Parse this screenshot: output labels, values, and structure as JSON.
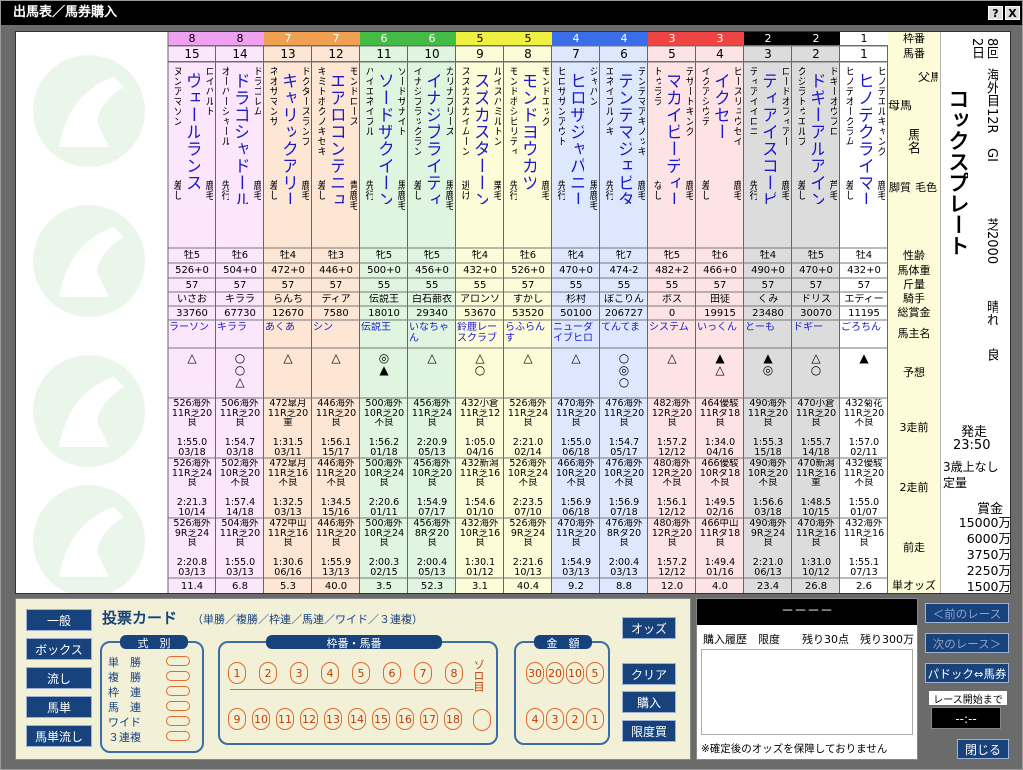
{
  "window": {
    "title": "出馬表／馬券購入",
    "help": "?",
    "close": "X"
  },
  "race": {
    "kai": "8回",
    "place_day": "海外目",
    "day": "2日",
    "race_no": "12R",
    "grade": "GI",
    "name": "コックスプレート",
    "course": "芝2000",
    "weather": "晴れ",
    "ground": "良",
    "start_label": "発走",
    "start_time": "23:50",
    "condition": "3歳上なし",
    "weight_rule": "定量",
    "prize_label": "賞金",
    "prizes": [
      "15000万",
      "6000万",
      "3750万",
      "2250万",
      "1500万"
    ]
  },
  "row_labels": {
    "waku": "枠番",
    "uma": "馬番",
    "dad": "父馬",
    "mom": "母馬",
    "name": "馬名",
    "leg": "脚質",
    "coat": "毛色",
    "sex_age": "性齢",
    "weight": "馬体重",
    "kin": "斤量",
    "jockey": "騎手",
    "money": "総賞金",
    "owner": "馬主名",
    "yoso": "予想",
    "r3": "3走前",
    "r2": "2走前",
    "r1": "前走",
    "odds": "単オッズ"
  },
  "columns": [
    {
      "waku": "8",
      "uma": "15",
      "name": "ヴェールランス",
      "dad": "ロイバルト",
      "mom": "ヌンアマソン",
      "leg": "差し",
      "coat": "鹿毛",
      "sex_age": "牡5",
      "weight": "526+0",
      "kin": "57",
      "jockey": "いさお",
      "money": "33760",
      "owner": "ラーソン",
      "yoso": [
        "△"
      ],
      "r3": [
        "526海外",
        "11R芝20",
        "良",
        "",
        "1:55.0",
        "03/18"
      ],
      "r2": [
        "526海外",
        "11R芝24",
        "良",
        "",
        "2:21.3",
        "10/14"
      ],
      "r1": [
        "526海外",
        "9R芝24",
        "良",
        "",
        "2:20.8",
        "03/13"
      ],
      "odds": "11.4"
    },
    {
      "waku": "8",
      "uma": "14",
      "name": "ドラゴシャドール",
      "dad": "ドラゴレム",
      "mom": "オーバーシャール",
      "leg": "先行",
      "coat": "鹿毛",
      "sex_age": "牡6",
      "weight": "504+0",
      "kin": "57",
      "jockey": "キララ",
      "money": "67730",
      "owner": "キララ",
      "yoso": [
        "○",
        "○",
        "△"
      ],
      "r3": [
        "506海外",
        "11R芝20",
        "良",
        "",
        "1:54.7",
        "03/18"
      ],
      "r2": [
        "502海外",
        "10R芝20",
        "不良",
        "",
        "1:57.4",
        "14/18"
      ],
      "r1": [
        "504海外",
        "11R芝20",
        "良",
        "",
        "1:55.0",
        "03/13"
      ],
      "odds": "6.8"
    },
    {
      "waku": "7",
      "uma": "13",
      "name": "キャリックアリード",
      "dad": "ドクタースランプ",
      "mom": "ネオサマンサ",
      "leg": "差し",
      "coat": "鹿毛",
      "sex_age": "牡4",
      "weight": "472+0",
      "kin": "57",
      "jockey": "らんち",
      "money": "12670",
      "owner": "あくあ",
      "yoso": [
        "△"
      ],
      "r3": [
        "472皐月",
        "11R芝20",
        "重",
        "",
        "1:31.5",
        "03/11"
      ],
      "r2": [
        "472皐月",
        "11R芝16",
        "不良",
        "",
        "1:32.5",
        "03/13"
      ],
      "r1": [
        "472中山",
        "11R芝16",
        "良",
        "",
        "1:30.6",
        "06/16"
      ],
      "odds": "5.3"
    },
    {
      "waku": "7",
      "uma": "12",
      "name": "エアロコンテニュー",
      "dad": "モンドロース",
      "mom": "キミトボクノキセキ",
      "leg": "差し",
      "coat": "青鹿毛",
      "sex_age": "牡3",
      "weight": "446+0",
      "kin": "57",
      "jockey": "ディア",
      "money": "7580",
      "owner": "シン",
      "yoso": [
        "△"
      ],
      "r3": [
        "446海外",
        "11R芝20",
        "良",
        "",
        "1:56.1",
        "15/17"
      ],
      "r2": [
        "446海外",
        "11R芝20",
        "不良",
        "",
        "1:34.5",
        "15/16"
      ],
      "r1": [
        "446海外",
        "11R芝20",
        "良",
        "",
        "1:55.9",
        "13/13"
      ],
      "odds": "40.0"
    },
    {
      "waku": "6",
      "uma": "11",
      "name": "ソードザクイーン",
      "dad": "ソードザナイト",
      "mom": "ハイエネイブル",
      "leg": "先行",
      "coat": "黒鹿毛",
      "sex_age": "牝5",
      "weight": "500+0",
      "kin": "55",
      "jockey": "伝説王",
      "money": "18010",
      "owner": "伝説王",
      "yoso": [
        "◎",
        "▲"
      ],
      "r3": [
        "500海外",
        "10R芝20",
        "不良",
        "",
        "1:56.2",
        "01/18"
      ],
      "r2": [
        "500海外",
        "10R芝24",
        "良",
        "",
        "2:20.6",
        "01/11"
      ],
      "r1": [
        "500海外",
        "10R芝24",
        "良",
        "",
        "2:00.3",
        "02/15"
      ],
      "odds": "3.5"
    },
    {
      "waku": "6",
      "uma": "10",
      "name": "イナジブライティ",
      "dad": "カリナブリーズ",
      "mom": "イナジブラックラン",
      "leg": "差し",
      "coat": "黒鹿毛",
      "sex_age": "牝5",
      "weight": "456+0",
      "kin": "55",
      "jockey": "白石蔀衣",
      "money": "29340",
      "owner": "いなちゃん",
      "yoso": [
        "△"
      ],
      "r3": [
        "456海外",
        "11R芝24",
        "良",
        "",
        "2:20.9",
        "05/13"
      ],
      "r2": [
        "456海外",
        "10R芝20",
        "良",
        "",
        "1:54.9",
        "07/17"
      ],
      "r1": [
        "456海外",
        "8Rダ20",
        "良",
        "",
        "2:00.4",
        "05/13"
      ],
      "odds": "52.3"
    },
    {
      "waku": "5",
      "uma": "9",
      "name": "スズカスターーン",
      "dad": "ルイスハミルトン",
      "mom": "スズカスカイムーン",
      "leg": "逃げ",
      "coat": "栗毛",
      "sex_age": "牝4",
      "weight": "432+0",
      "kin": "55",
      "jockey": "アロンソ",
      "money": "53670",
      "owner": "鈴鹿レースクラブ",
      "yoso": [
        "△",
        "○"
      ],
      "r3": [
        "432小倉",
        "11R芝12",
        "良",
        "",
        "1:05.0",
        "04/16"
      ],
      "r2": [
        "432新潟",
        "11R芝16",
        "良",
        "",
        "1:54.6",
        "01/10"
      ],
      "r1": [
        "432海外",
        "10R芝16",
        "良",
        "",
        "1:30.1",
        "01/12"
      ],
      "odds": "3.1"
    },
    {
      "waku": "5",
      "uma": "8",
      "name": "モンドヨウカツ",
      "dad": "モンドエッグ",
      "mom": "モンドポシビリティ",
      "leg": "先行",
      "coat": "鹿毛",
      "sex_age": "牡6",
      "weight": "526+0",
      "kin": "57",
      "jockey": "すかし",
      "money": "53520",
      "owner": "らふらんす",
      "yoso": [
        "△"
      ],
      "r3": [
        "526海外",
        "11R芝24",
        "良",
        "",
        "2:21.0",
        "02/14"
      ],
      "r2": [
        "526海外",
        "10R芝24",
        "不良",
        "",
        "2:23.5",
        "07/10"
      ],
      "r1": [
        "526海外",
        "9R芝24",
        "良",
        "",
        "2:21.6",
        "10/13"
      ],
      "odds": "40.4"
    },
    {
      "waku": "4",
      "uma": "7",
      "name": "ヒロザジャパニーズ",
      "dad": "ジャパン",
      "mom": "ヒロザサンアウト",
      "leg": "先行",
      "coat": "黒鹿毛",
      "sex_age": "牝4",
      "weight": "470+0",
      "kin": "55",
      "jockey": "杉村",
      "money": "50100",
      "owner": "ニューダイブヒロ",
      "yoso": [
        "△"
      ],
      "r3": [
        "470海外",
        "11R芝20",
        "良",
        "",
        "1:55.0",
        "06/18"
      ],
      "r2": [
        "466海外",
        "10R芝20",
        "不良",
        "",
        "1:56.9",
        "06/18"
      ],
      "r1": [
        "470海外",
        "11R芝20",
        "良",
        "",
        "1:54.9",
        "03/13"
      ],
      "odds": "9.2"
    },
    {
      "waku": "4",
      "uma": "6",
      "name": "テンテマジェビター",
      "dad": "テンテマアキノッキ",
      "mom": "エネイブルノキ",
      "leg": "先行",
      "coat": "鹿毛",
      "sex_age": "牝7",
      "weight": "474-2",
      "kin": "55",
      "jockey": "ぼこりん",
      "money": "206727",
      "owner": "てんてま",
      "yoso": [
        "○",
        "◎",
        "○"
      ],
      "r3": [
        "476海外",
        "11R芝20",
        "良",
        "",
        "1:54.7",
        "05/17"
      ],
      "r2": [
        "476海外",
        "10R芝20",
        "不良",
        "",
        "1:56.9",
        "07/18"
      ],
      "r1": [
        "476海外",
        "8Rダ20",
        "良",
        "",
        "2:00.4",
        "03/13"
      ],
      "odds": "8.8"
    },
    {
      "waku": "3",
      "uma": "5",
      "name": "マカイビーディーヴ",
      "dad": "デザートキング",
      "mom": "トゥララ",
      "leg": "なし",
      "coat": "鹿毛",
      "sex_age": "牝5",
      "weight": "482+2",
      "kin": "55",
      "jockey": "ボス",
      "money": "0",
      "owner": "システム",
      "yoso": [
        "△"
      ],
      "r3": [
        "482海外",
        "12R芝20",
        "良",
        "",
        "1:57.2",
        "12/12"
      ],
      "r2": [
        "480海外",
        "12R芝20",
        "不良",
        "",
        "1:56.1",
        "12/12"
      ],
      "r1": [
        "480海外",
        "12R芝20",
        "良",
        "",
        "1:57.2",
        "12/12"
      ],
      "odds": "12.0"
    },
    {
      "waku": "3",
      "uma": "4",
      "name": "イクセー",
      "dad": "ピースリュウセイ",
      "mom": "イクアシウテ",
      "leg": "差し",
      "coat": "鹿毛",
      "sex_age": "牡6",
      "weight": "466+0",
      "kin": "57",
      "jockey": "田徒",
      "money": "19915",
      "owner": "いっくん",
      "yoso": [
        "▲",
        "△"
      ],
      "r3": [
        "464優駿",
        "11Rダ18",
        "良",
        "",
        "1:34.0",
        "04/16"
      ],
      "r2": [
        "466優駿",
        "10Rダ18",
        "不良",
        "",
        "1:49.5",
        "02/16"
      ],
      "r1": [
        "466中山",
        "11Rダ18",
        "良",
        "",
        "1:49.4",
        "01/16"
      ],
      "odds": "4.0"
    },
    {
      "waku": "2",
      "uma": "3",
      "name": "ティアイスコーピオ",
      "dad": "ロードオフィアー",
      "mom": "ティアイイロニ",
      "leg": "先行",
      "coat": "鹿毛",
      "sex_age": "牡4",
      "weight": "490+0",
      "kin": "57",
      "jockey": "くみ",
      "money": "23480",
      "owner": "とーも",
      "yoso": [
        "▲",
        "◎"
      ],
      "r3": [
        "490海外",
        "11R芝20",
        "良",
        "",
        "1:55.3",
        "15/18"
      ],
      "r2": [
        "490海外",
        "10R芝20",
        "不良",
        "",
        "1:56.6",
        "03/18"
      ],
      "r1": [
        "490海外",
        "9R芝24",
        "良",
        "",
        "2:21.0",
        "06/13"
      ],
      "odds": "23.4"
    },
    {
      "waku": "2",
      "uma": "2",
      "name": "ドギーアルアイン",
      "dad": "ドギーオウフロ",
      "mom": "クジラトゥエルブ",
      "leg": "差し",
      "coat": "芦毛",
      "sex_age": "牡5",
      "weight": "470+0",
      "kin": "57",
      "jockey": "ドリス",
      "money": "30070",
      "owner": "ドギー",
      "yoso": [
        "△",
        "○"
      ],
      "r3": [
        "470小倉",
        "11R芝20",
        "良",
        "",
        "1:55.7",
        "14/18"
      ],
      "r2": [
        "470新潟",
        "11R芝16",
        "重",
        "",
        "1:48.5",
        "10/15"
      ],
      "r1": [
        "470海外",
        "11R芝16",
        "良",
        "",
        "1:31.0",
        "10/12"
      ],
      "odds": "26.8"
    },
    {
      "waku": "1",
      "uma": "1",
      "name": "ヒノデクライマー",
      "dad": "ヒノデエルキャング",
      "mom": "ヒノデオークラム",
      "leg": "差し",
      "coat": "鹿毛",
      "sex_age": "牡4",
      "weight": "432+0",
      "kin": "57",
      "jockey": "エディー",
      "money": "11195",
      "owner": "ごろちん",
      "yoso": [
        "▲"
      ],
      "r3": [
        "432菊花",
        "11R芝20",
        "不良",
        "",
        "1:57.0",
        "02/11"
      ],
      "r2": [
        "432優駿",
        "11R芝20",
        "不良",
        "",
        "1:55.0",
        "01/07"
      ],
      "r1": [
        "432海外",
        "11R芝16",
        "良",
        "",
        "1:55.1",
        "07/13"
      ],
      "odds": "2.6"
    }
  ],
  "waku_colors": {
    "8": "#f0a0f0",
    "7": "#f0a050",
    "6": "#44bb44",
    "5": "#f0f040",
    "4": "#3a6ee8",
    "3": "#ee4444",
    "2": "#000000",
    "1": "#ffffff"
  },
  "bg_colors": {
    "8": "#fbe6fb",
    "7": "#fde6d4",
    "6": "#dff5df",
    "5": "#fdfcd8",
    "4": "#dde8ff",
    "3": "#fde3e3",
    "2": "#dcdcdc",
    "1": "#ffffff"
  },
  "left_buttons": [
    "一般",
    "ボックス",
    "流し",
    "馬単",
    "馬単流し"
  ],
  "ticket": {
    "title": "投票カード",
    "subtitle": "（単勝／複勝／枠連／馬連／ワイド／３連複）",
    "shiki_label": "式　別",
    "bets": [
      "単　勝",
      "複　勝",
      "枠　連",
      "馬　連",
      "ワイド",
      "３連複"
    ],
    "uma_label": "枠番・馬番",
    "row1": [
      "1",
      "2",
      "3",
      "4",
      "5",
      "6",
      "7",
      "8"
    ],
    "row2": [
      "9",
      "10",
      "11",
      "12",
      "13",
      "14",
      "15",
      "16",
      "17",
      "18"
    ],
    "zoro": "ゾロ目",
    "kin_label": "金　額",
    "amt1": [
      "30",
      "20",
      "10",
      "5"
    ],
    "amt2": [
      "4",
      "3",
      "2",
      "1"
    ]
  },
  "right_buttons": {
    "odds": "オッズ",
    "clear": "クリア",
    "buy": "購入",
    "limit": "限度買"
  },
  "history": {
    "dashes": "－－－－",
    "header": "購入履歴　限度　　残り30点　残り300万",
    "note": "※確定後のオッズを保障しておりません"
  },
  "nav": {
    "prev": "＜前のレース",
    "next": "次のレース＞",
    "paddock": "パドック⇔馬券",
    "countdown_label": "レース開始まで",
    "countdown": "--:--",
    "close": "閉じる"
  }
}
